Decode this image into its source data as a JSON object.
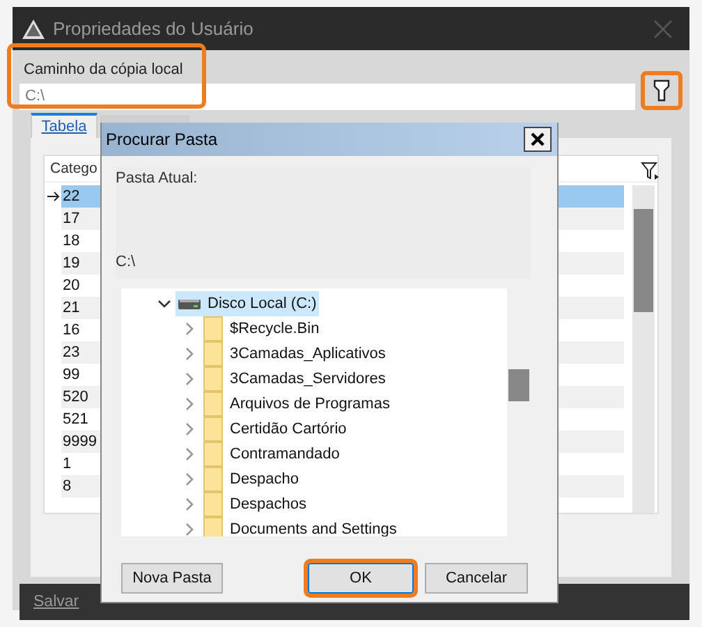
{
  "window": {
    "title": "Propriedades do Usuário"
  },
  "path_field": {
    "label": "Caminho da cópia local",
    "value": "C:\\",
    "highlighted": true
  },
  "browse_button": {
    "highlighted": true
  },
  "tabs": [
    {
      "label": "Tabela",
      "selected": true
    },
    {
      "selected": false
    }
  ],
  "table": {
    "columns": [
      "Catego"
    ],
    "rows": [
      {
        "cell": "22",
        "selected": true,
        "current": true
      },
      {
        "cell": "17",
        "selected": false,
        "current": false
      },
      {
        "cell": "18",
        "selected": false,
        "current": false
      },
      {
        "cell": "19",
        "selected": false,
        "current": false
      },
      {
        "cell": "20",
        "selected": false,
        "current": false
      },
      {
        "cell": "21",
        "selected": false,
        "current": false
      },
      {
        "cell": "16",
        "selected": false,
        "current": false
      },
      {
        "cell": "23",
        "selected": false,
        "current": false
      },
      {
        "cell": "99",
        "selected": false,
        "current": false
      },
      {
        "cell": "520",
        "selected": false,
        "current": false
      },
      {
        "cell": "521",
        "selected": false,
        "current": false
      },
      {
        "cell": "9999",
        "selected": false,
        "current": false
      },
      {
        "cell": "1",
        "selected": false,
        "current": false
      },
      {
        "cell": "8",
        "selected": false,
        "current": false
      }
    ]
  },
  "bottom_bar": {
    "buttons": [
      "Salvar"
    ]
  },
  "dialog": {
    "title": "Procurar Pasta",
    "current_folder_label": "Pasta Atual:",
    "current_folder": "C:\\",
    "tree": [
      {
        "label": "Disco Local (C:)",
        "kind": "drive",
        "expanded": true,
        "selected": true,
        "children": [
          {
            "label": "$Recycle.Bin",
            "kind": "folder",
            "expanded": false,
            "selected": false
          },
          {
            "label": "3Camadas_Aplicativos",
            "kind": "folder",
            "expanded": false,
            "selected": false
          },
          {
            "label": "3Camadas_Servidores",
            "kind": "folder",
            "expanded": false,
            "selected": false
          },
          {
            "label": "Arquivos de Programas",
            "kind": "folder",
            "expanded": false,
            "selected": false
          },
          {
            "label": "Certidão Cartório",
            "kind": "folder",
            "expanded": false,
            "selected": false
          },
          {
            "label": "Contramandado",
            "kind": "folder",
            "expanded": false,
            "selected": false
          },
          {
            "label": "Despacho",
            "kind": "folder",
            "expanded": false,
            "selected": false
          },
          {
            "label": "Despachos",
            "kind": "folder",
            "expanded": false,
            "selected": false
          },
          {
            "label": "Documents and Settings",
            "kind": "folder",
            "expanded": false,
            "selected": false
          }
        ]
      }
    ],
    "buttons": [
      {
        "label": "Nova Pasta",
        "kind": "secondary",
        "highlighted": false
      },
      {
        "label": "OK",
        "kind": "primary",
        "highlighted": true
      },
      {
        "label": "Cancelar",
        "kind": "secondary",
        "highlighted": false
      }
    ]
  }
}
